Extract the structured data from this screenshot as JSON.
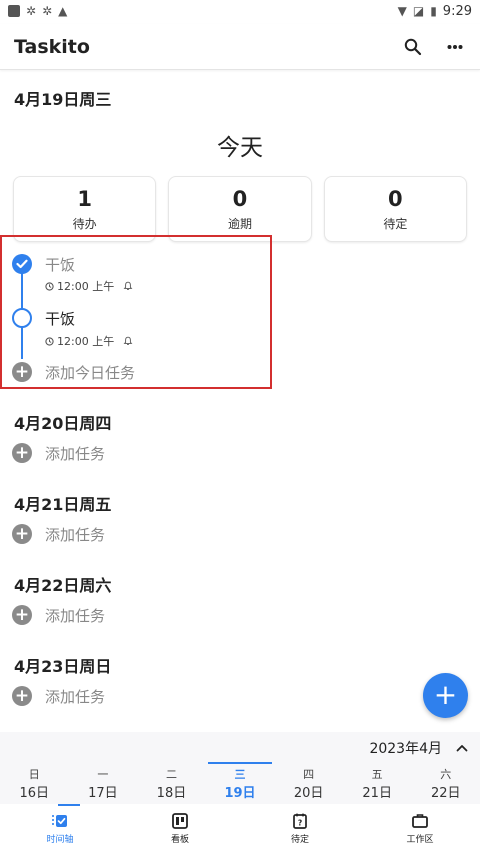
{
  "status_bar": {
    "time": "9:29"
  },
  "app": {
    "title": "Taskito"
  },
  "today": {
    "date_header": "4月19日周三",
    "title": "今天",
    "stats": [
      {
        "value": "1",
        "label": "待办"
      },
      {
        "value": "0",
        "label": "逾期"
      },
      {
        "value": "0",
        "label": "待定"
      }
    ],
    "tasks": [
      {
        "title": "干饭",
        "time": "12:00 上午",
        "completed": true
      },
      {
        "title": "干饭",
        "time": "12:00 上午",
        "completed": false
      }
    ],
    "add_label": "添加今日任务"
  },
  "days": [
    {
      "header": "4月20日周四",
      "add_label": "添加任务"
    },
    {
      "header": "4月21日周五",
      "add_label": "添加任务"
    },
    {
      "header": "4月22日周六",
      "add_label": "添加任务"
    },
    {
      "header": "4月23日周日",
      "add_label": "添加任务"
    }
  ],
  "calendar": {
    "month_label": "2023年4月",
    "week": [
      {
        "weekday": "日",
        "date": "16日"
      },
      {
        "weekday": "一",
        "date": "17日"
      },
      {
        "weekday": "二",
        "date": "18日"
      },
      {
        "weekday": "三",
        "date": "19日",
        "selected": true
      },
      {
        "weekday": "四",
        "date": "20日"
      },
      {
        "weekday": "五",
        "date": "21日"
      },
      {
        "weekday": "六",
        "date": "22日"
      }
    ]
  },
  "bottom_nav": [
    {
      "label": "时间轴",
      "icon": "timeline-icon",
      "active": true
    },
    {
      "label": "看板",
      "icon": "board-icon"
    },
    {
      "label": "待定",
      "icon": "pending-icon"
    },
    {
      "label": "工作区",
      "icon": "workspace-icon"
    }
  ],
  "colors": {
    "accent": "#2f80ed",
    "highlight_border": "#d32f2f",
    "muted": "#8a8a8a"
  }
}
